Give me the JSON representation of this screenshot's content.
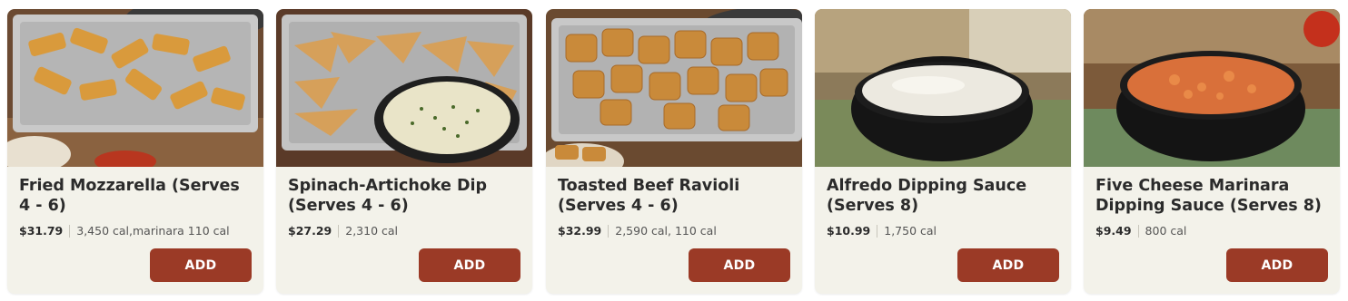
{
  "colors": {
    "card_bg": "#f3f2ea",
    "button_bg": "#9b3a26",
    "button_text": "#ffffff"
  },
  "items": [
    {
      "title": "Fried Mozzarella (Serves 4 - 6)",
      "price": "$31.79",
      "calories": "3,450 cal,marinara 110 cal",
      "add_label": "ADD",
      "image_icon": "fried-mozzarella-photo"
    },
    {
      "title": "Spinach-Artichoke Dip (Serves 4 - 6)",
      "price": "$27.29",
      "calories": "2,310 cal",
      "add_label": "ADD",
      "image_icon": "spinach-artichoke-dip-photo"
    },
    {
      "title": "Toasted Beef Ravioli (Serves 4 - 6)",
      "price": "$32.99",
      "calories": "2,590 cal, 110 cal",
      "add_label": "ADD",
      "image_icon": "toasted-beef-ravioli-photo"
    },
    {
      "title": "Alfredo Dipping Sauce (Serves 8)",
      "price": "$10.99",
      "calories": "1,750 cal",
      "add_label": "ADD",
      "image_icon": "alfredo-sauce-photo"
    },
    {
      "title": "Five Cheese Marinara Dipping Sauce (Serves 8)",
      "price": "$9.49",
      "calories": "800 cal",
      "add_label": "ADD",
      "image_icon": "five-cheese-marinara-photo"
    }
  ]
}
